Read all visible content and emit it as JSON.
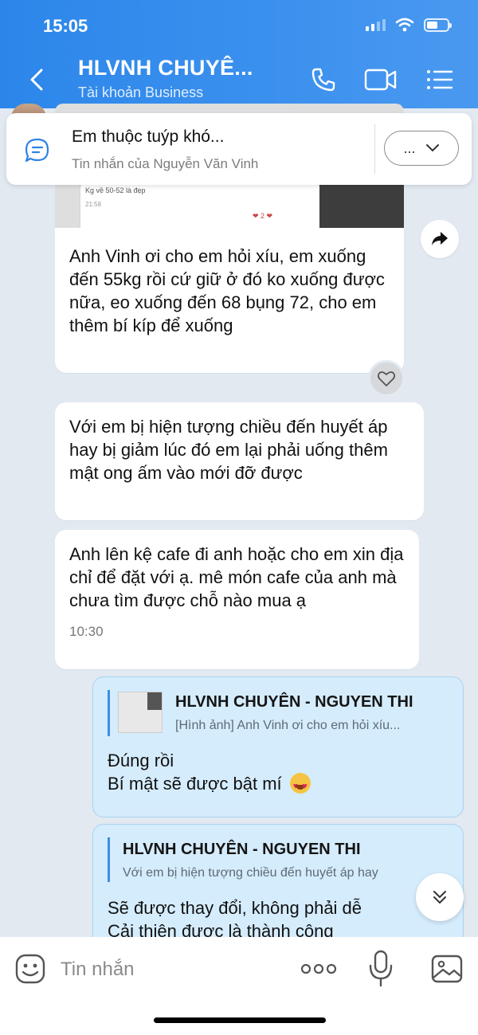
{
  "status_bar": {
    "time": "15:05"
  },
  "header": {
    "title": "HLVNH CHUYÊ...",
    "subtitle": "Tài khoản Business",
    "icons": [
      "back-icon",
      "phone-icon",
      "video-icon",
      "menu-list-icon"
    ]
  },
  "pinned": {
    "title": "Em thuộc tuýp khó...",
    "subtitle": "Tin nhắn của Nguyễn Văn Vinh",
    "more_label": "..."
  },
  "image_card": {
    "text1": "Kg về 50-52 là đẹp",
    "text2": "21:58",
    "hearts": "❤ 2 ❤"
  },
  "messages": [
    {
      "text": "Anh Vinh ơi cho em hỏi xíu, em xuống đến 55kg rồi cứ giữ ở đó ko xuống được nữa, eo xuống đến 68 bụng 72, cho em thêm bí kíp để xuống"
    },
    {
      "text": "Với em bị hiện tượng chiều đến huyết áp hay bị giảm lúc đó em lại phải uống thêm mật ong ấm vào mới đỡ được"
    },
    {
      "text": "Anh lên kệ cafe đi anh hoặc cho em xin địa chỉ để đặt với ạ. mê món cafe của anh mà chưa tìm được chỗ nào mua ạ",
      "time": "10:30"
    }
  ],
  "replies": [
    {
      "quote_name": "HLVNH CHUYÊN - NGUYEN THI",
      "quote_text": "[Hình ảnh] Anh Vinh ơi cho em hỏi xíu...",
      "line1": "Đúng rồi",
      "line2": "Bí mật sẽ được bật mí"
    },
    {
      "quote_name": "HLVNH CHUYÊN - NGUYEN THI",
      "quote_text": "Với em bị hiện tượng chiều đến huyết áp hay",
      "line1": "Sẽ được thay đổi, không phải dễ",
      "line2": "Cải thiện được là thành công"
    }
  ],
  "composer": {
    "placeholder": "Tin nhắn"
  },
  "colors": {
    "header_blue": "#3c91ee",
    "reply_bg": "#d5ecfc",
    "accent": "#3b8de3"
  }
}
